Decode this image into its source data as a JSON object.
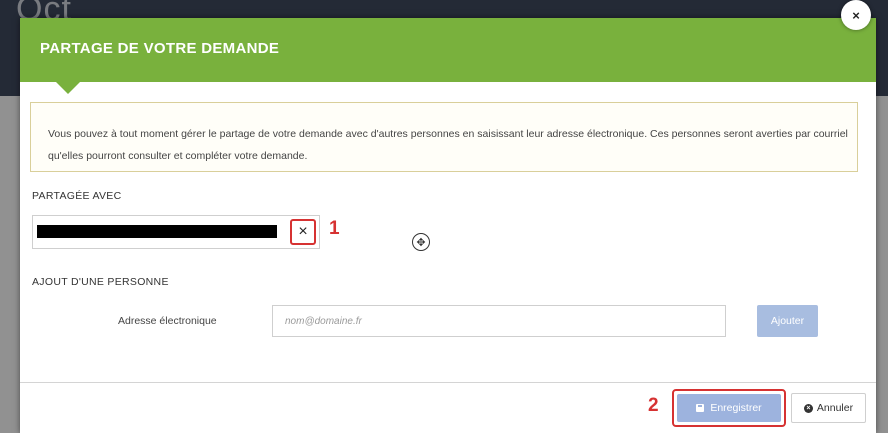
{
  "background": {
    "logo_text": "Oct"
  },
  "modal": {
    "title": "PARTAGE DE VOTRE DEMANDE",
    "close_label": "×",
    "info_text": "Vous pouvez à tout moment gérer le partage de votre demande avec d'autres personnes en saisissant leur adresse électronique. Ces personnes seront averties par courriel qu'elles pourront consulter et compléter votre demande.",
    "shared_with": {
      "label": "PARTAGÉE AVEC",
      "remove_label": "×",
      "marker": "1"
    },
    "add_person": {
      "label": "AJOUT D'UNE PERSONNE",
      "field_label": "Adresse électronique",
      "placeholder": "nom@domaine.fr",
      "value": "",
      "add_button": "Ajouter"
    },
    "footer": {
      "marker": "2",
      "save_button": "Enregistrer",
      "cancel_button": "Annuler"
    }
  },
  "colors": {
    "header": "#79b13d",
    "highlight": "#d63232",
    "button_disabled": "#9db3de"
  },
  "icons": [
    "close-icon",
    "move-icon",
    "save-icon",
    "cancel-icon"
  ]
}
